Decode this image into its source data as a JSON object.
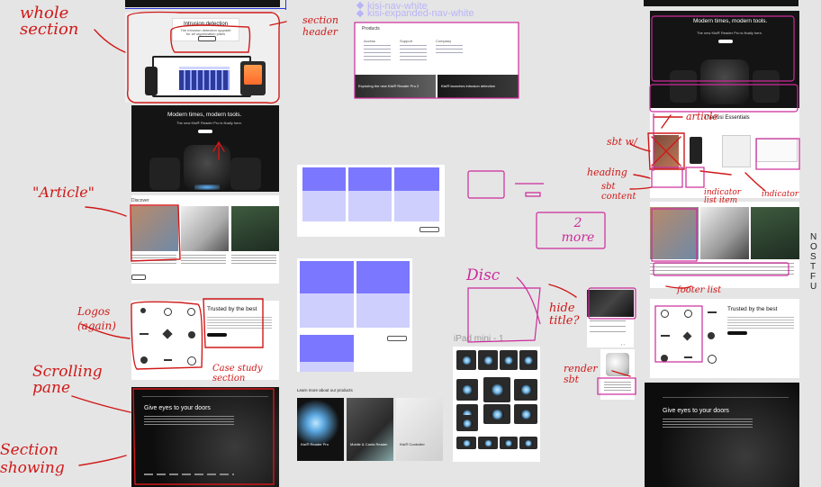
{
  "annotations": {
    "whole_section": "whole section",
    "section_header": "section header",
    "article_left": "\"Article\"",
    "logos_again": "Logos (again)",
    "case_study": "Case study section",
    "scrolling_pane": "Scrolling pane",
    "section_showing": "Section showing",
    "two_more": "2 more",
    "disc": "Disc",
    "hide_title": "hide title?",
    "render_sbt": "render sbt",
    "article_right": "article",
    "sbt_w": "sbt w/",
    "heading": "heading",
    "sbt_content": "sbt content",
    "indicator": "indicator",
    "indicator_list_item": "indicator list item",
    "footer_list": "footer list",
    "stub": "NO ST FU"
  },
  "frames": {
    "nav_white": "kisi-nav-white",
    "nav_expanded": "kisi-expanded-nav-white",
    "ipad_label": "iPad mini - 1",
    "learn_more": "Learn more about our products"
  },
  "content": {
    "intrusion_title": "Intrusion detection",
    "intrusion_sub": "The intrusion detection upgrade for all organization plans",
    "modern_title": "Modern times, modern tools.",
    "modern_sub": "The new Kisi® Reader Pro is finally here.",
    "discover": "Discover",
    "trusted": "Trusted by the best",
    "eyes_title": "Give eyes to your doors",
    "kisi_essentials": "The Kisi Essentials",
    "products": "Products",
    "product_cards": [
      "Kisi® Reader Pro",
      "Mobile & Cards Reader",
      "Kisi® Controller"
    ],
    "nav_cols": [
      "Access",
      "Support",
      "Company"
    ],
    "promo_left": "Exploring the new Kisi® Reader Pro 2",
    "promo_right": "Kisi® launches intrusion detection"
  },
  "colors": {
    "annotation_red": "#d01818",
    "annotation_magenta": "#cc2a9a",
    "card_purple": "#7b78ff",
    "card_lavender": "#cfcffd",
    "nav_text": "#b9b4f7"
  }
}
